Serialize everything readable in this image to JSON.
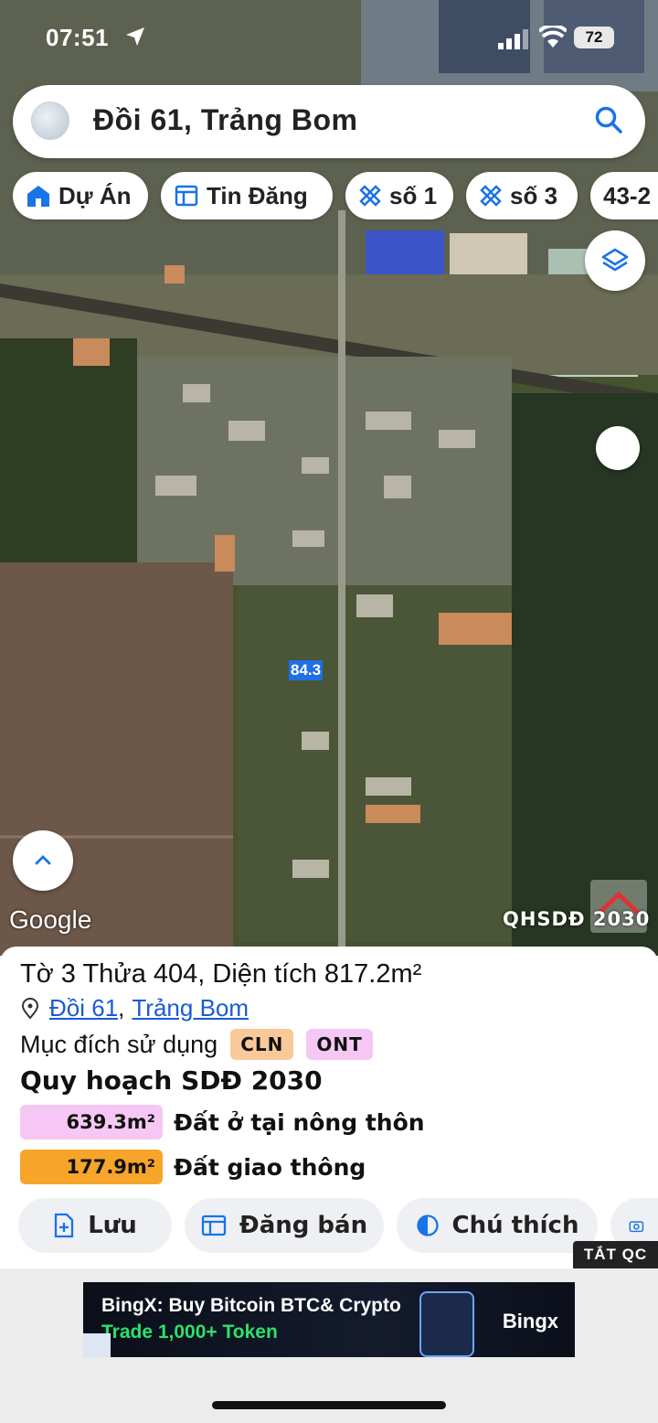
{
  "status_bar": {
    "time": "07:51",
    "battery": "72"
  },
  "search": {
    "query": "Đồi 61, Trảng Bom"
  },
  "filter_chips": [
    {
      "label": "Dự Án",
      "icon": "project-icon"
    },
    {
      "label": "Tin Đăng",
      "icon": "listing-icon"
    },
    {
      "label": "số 1",
      "icon": "ruler-icon"
    },
    {
      "label": "số 3",
      "icon": "ruler-icon"
    },
    {
      "label": "43-2",
      "icon": ""
    }
  ],
  "map": {
    "plot_label": "84.3",
    "google_logo": "Google",
    "watermark": "QHSDĐ 2030",
    "buttons": [
      "layers-icon",
      "circle-toggle",
      "expand-up-icon"
    ]
  },
  "parcel": {
    "title": "Tờ 3 Thửa 404, Diện tích 817.2m²",
    "location_links": [
      "Đồi 61",
      "Trảng Bom"
    ],
    "purpose_label": "Mục đích sử dụng",
    "purpose_tags": [
      {
        "code": "CLN",
        "color": "#f9c99a"
      },
      {
        "code": "ONT",
        "color": "#f6c7f4"
      }
    ],
    "plan_title": "Quy hoạch SDĐ 2030",
    "plan_items": [
      {
        "area": "639.3m²",
        "name": "Đất ở tại nông thôn",
        "color": "#f6c7f4"
      },
      {
        "area": "177.9m²",
        "name": "Đất giao thông",
        "color": "#f7a42b"
      }
    ]
  },
  "actions": [
    {
      "label": "Lưu",
      "icon": "save-icon"
    },
    {
      "label": "Đăng bán",
      "icon": "post-icon"
    },
    {
      "label": "Chú thích",
      "icon": "legend-icon"
    }
  ],
  "ad": {
    "close_label": "TẮT QC",
    "line1": "BingX: Buy Bitcoin BTC& Crypto",
    "line2": "Trade 1,000+ Token",
    "brand": "Bingx"
  }
}
